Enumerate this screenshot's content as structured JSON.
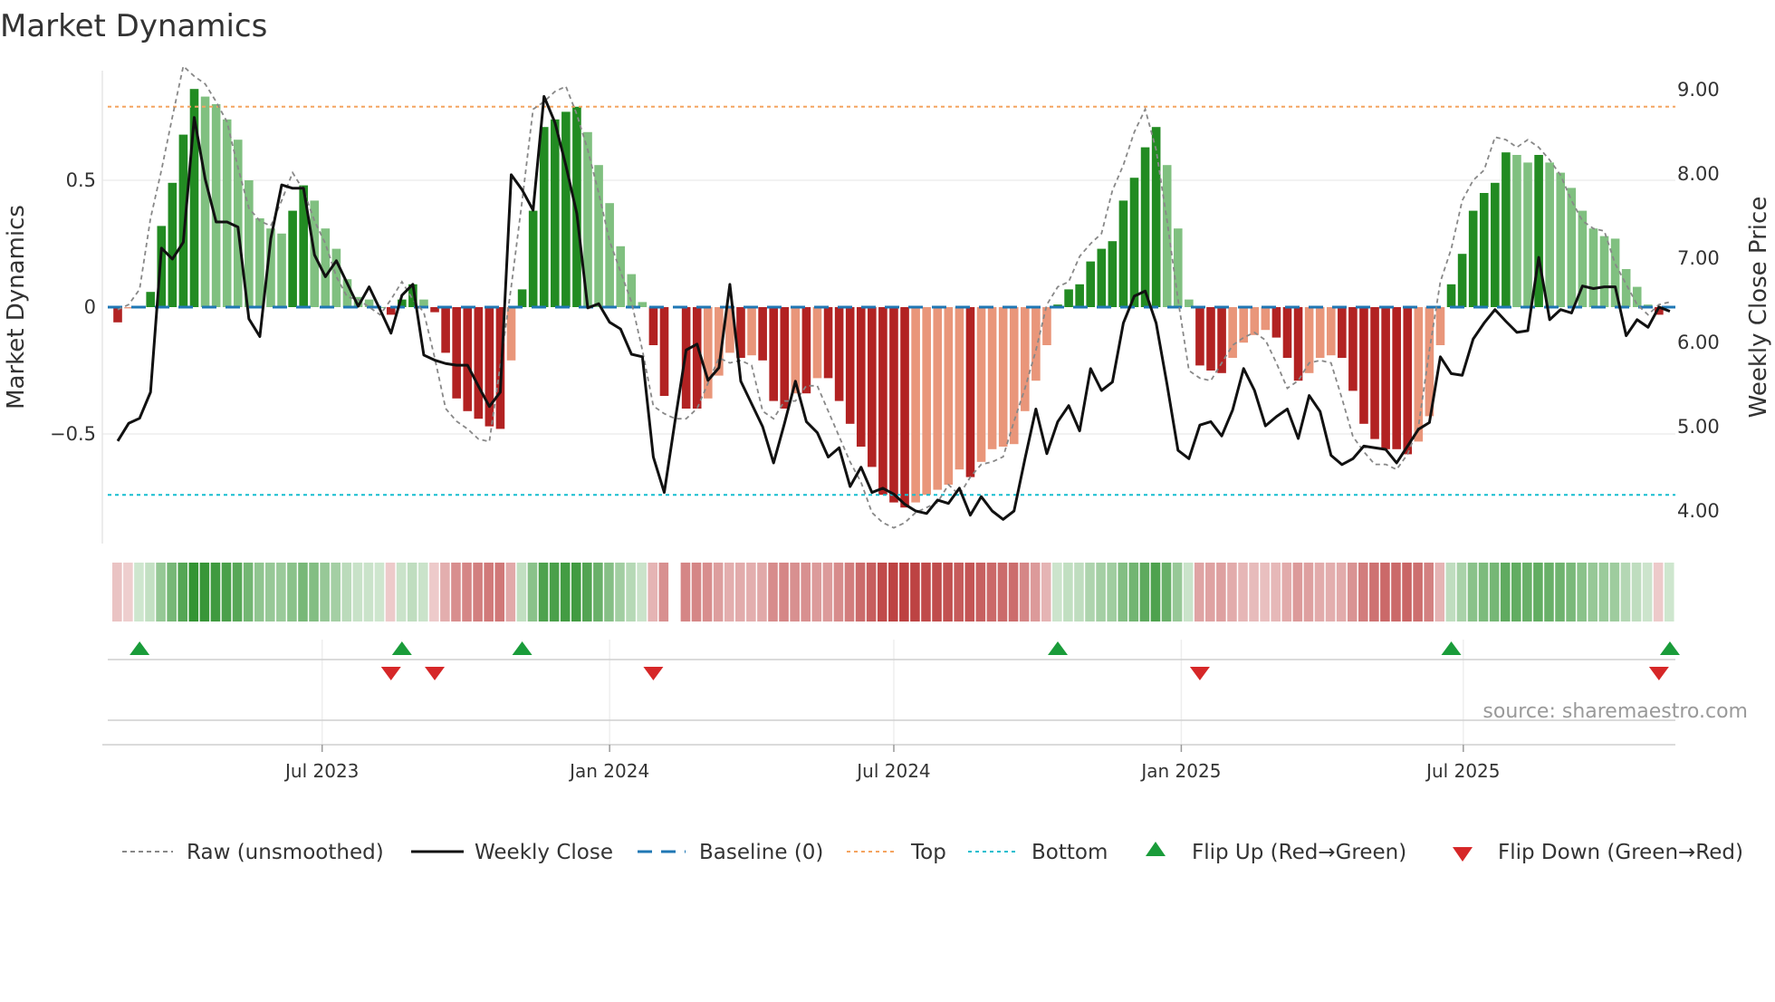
{
  "title": "Market Dynamics",
  "source": "source: sharemaestro.com",
  "colors": {
    "green_dark": "#228b22",
    "green_light": "#80c080",
    "red_dark": "#b22222",
    "red_light": "#e9967a",
    "top": "#f4a460",
    "bottom": "#17becf",
    "baseline": "#1f77b4",
    "price": "#111111",
    "raw": "#888888",
    "flip_up": "#1a9c3a",
    "flip_down": "#d62728"
  },
  "chart_data": {
    "type": "bar+line",
    "title": "Market Dynamics",
    "ylabel_left": "Market Dynamics",
    "ylabel_right": "Weekly Close Price",
    "left_ticks": [
      {
        "v": 0.5,
        "label": "0.5"
      },
      {
        "v": 0,
        "label": "0"
      },
      {
        "v": -0.5,
        "label": "−0.5"
      }
    ],
    "right_ticks": [
      {
        "v": 9,
        "label": "9.00"
      },
      {
        "v": 8,
        "label": "8.00"
      },
      {
        "v": 7,
        "label": "7.00"
      },
      {
        "v": 6,
        "label": "6.00"
      },
      {
        "v": 5,
        "label": "5.00"
      },
      {
        "v": 4,
        "label": "4.00"
      }
    ],
    "x_ticks": [
      {
        "week": 18.7,
        "label": "Jul 2023"
      },
      {
        "week": 45.0,
        "label": "Jan 2024"
      },
      {
        "week": 71.0,
        "label": "Jul 2024"
      },
      {
        "week": 97.3,
        "label": "Jan 2025"
      },
      {
        "week": 123.1,
        "label": "Jul 2025"
      }
    ],
    "top_level": 0.79,
    "bottom_level": -0.74,
    "baseline": 0,
    "dynamics": [
      -0.06,
      -0.005,
      0.005,
      0.06,
      0.32,
      0.49,
      0.68,
      0.86,
      0.83,
      0.8,
      0.74,
      0.66,
      0.5,
      0.35,
      0.31,
      0.29,
      0.38,
      0.48,
      0.42,
      0.31,
      0.23,
      0.11,
      0.04,
      0.03,
      0.0,
      -0.03,
      0.03,
      0.09,
      0.03,
      -0.02,
      -0.18,
      -0.36,
      -0.41,
      -0.44,
      -0.47,
      -0.48,
      -0.21,
      0.07,
      0.38,
      0.71,
      0.74,
      0.77,
      0.79,
      0.69,
      0.56,
      0.41,
      0.24,
      0.13,
      0.02,
      -0.15,
      -0.35,
      null,
      -0.4,
      -0.4,
      -0.36,
      -0.27,
      -0.18,
      -0.2,
      -0.19,
      -0.21,
      -0.37,
      -0.4,
      -0.34,
      -0.34,
      -0.28,
      -0.28,
      -0.37,
      -0.46,
      -0.55,
      -0.63,
      -0.74,
      -0.77,
      -0.79,
      -0.77,
      -0.74,
      -0.72,
      -0.7,
      -0.64,
      -0.67,
      -0.61,
      -0.56,
      -0.55,
      -0.54,
      -0.41,
      -0.29,
      -0.15,
      0.01,
      0.07,
      0.09,
      0.18,
      0.23,
      0.26,
      0.42,
      0.51,
      0.63,
      0.71,
      0.56,
      0.31,
      0.03,
      -0.23,
      -0.25,
      -0.26,
      -0.2,
      -0.14,
      -0.11,
      -0.09,
      -0.12,
      -0.2,
      -0.29,
      -0.26,
      -0.2,
      -0.19,
      -0.2,
      -0.33,
      -0.46,
      -0.52,
      -0.56,
      -0.56,
      -0.58,
      -0.53,
      -0.43,
      -0.15,
      0.09,
      0.21,
      0.38,
      0.45,
      0.49,
      0.61,
      0.6,
      0.57,
      0.6,
      0.57,
      0.53,
      0.47,
      0.38,
      0.31,
      0.28,
      0.27,
      0.15,
      0.08,
      0.01,
      -0.03,
      0.005
    ],
    "raw": [
      -0.01,
      0.01,
      0.07,
      0.35,
      0.54,
      0.75,
      0.95,
      0.91,
      0.88,
      0.81,
      0.73,
      0.55,
      0.39,
      0.34,
      0.32,
      0.42,
      0.53,
      0.46,
      0.34,
      0.25,
      0.12,
      0.04,
      0.03,
      0.0,
      -0.03,
      0.03,
      0.1,
      0.03,
      -0.02,
      -0.2,
      -0.4,
      -0.45,
      -0.48,
      -0.52,
      -0.53,
      -0.23,
      0.08,
      0.42,
      0.78,
      0.81,
      0.85,
      0.87,
      0.76,
      0.62,
      0.45,
      0.26,
      0.14,
      0.02,
      -0.17,
      -0.39,
      -0.42,
      -0.44,
      -0.44,
      -0.4,
      -0.3,
      -0.2,
      -0.22,
      -0.21,
      -0.23,
      -0.41,
      -0.44,
      -0.37,
      -0.37,
      -0.31,
      -0.31,
      -0.41,
      -0.51,
      -0.61,
      -0.69,
      -0.81,
      -0.85,
      -0.87,
      -0.85,
      -0.81,
      -0.79,
      -0.77,
      -0.7,
      -0.74,
      -0.67,
      -0.62,
      -0.61,
      -0.59,
      -0.45,
      -0.32,
      -0.17,
      0.01,
      0.08,
      0.1,
      0.2,
      0.25,
      0.29,
      0.46,
      0.56,
      0.69,
      0.78,
      0.62,
      0.34,
      0.03,
      -0.25,
      -0.28,
      -0.29,
      -0.22,
      -0.15,
      -0.12,
      -0.1,
      -0.13,
      -0.22,
      -0.32,
      -0.29,
      -0.22,
      -0.21,
      -0.22,
      -0.36,
      -0.51,
      -0.57,
      -0.62,
      -0.62,
      -0.64,
      -0.58,
      -0.47,
      -0.17,
      0.1,
      0.23,
      0.42,
      0.5,
      0.54,
      0.67,
      0.66,
      0.63,
      0.66,
      0.63,
      0.58,
      0.52,
      0.42,
      0.34,
      0.31,
      0.3,
      0.17,
      0.09,
      0.01,
      -0.03,
      0.01,
      0.02
    ],
    "weekly_close": [
      4.83,
      5.04,
      5.1,
      5.41,
      7.12,
      6.99,
      7.19,
      8.67,
      7.94,
      7.43,
      7.43,
      7.37,
      6.28,
      6.07,
      7.23,
      7.87,
      7.83,
      7.83,
      7.04,
      6.78,
      6.97,
      6.7,
      6.43,
      6.66,
      6.39,
      6.11,
      6.56,
      6.69,
      5.85,
      5.79,
      5.75,
      5.73,
      5.73,
      5.48,
      5.24,
      5.41,
      7.99,
      7.81,
      7.57,
      8.92,
      8.61,
      8.1,
      7.53,
      6.41,
      6.46,
      6.24,
      6.16,
      5.86,
      5.83,
      4.64,
      4.22,
      5.08,
      5.91,
      5.98,
      5.55,
      5.7,
      6.69,
      5.54,
      5.27,
      5.0,
      4.57,
      5.04,
      5.54,
      5.06,
      4.93,
      4.64,
      4.75,
      4.29,
      4.52,
      4.22,
      4.27,
      4.2,
      4.08,
      4.0,
      3.97,
      4.13,
      4.09,
      4.27,
      3.95,
      4.17,
      4.0,
      3.9,
      4.0,
      4.62,
      5.21,
      4.68,
      5.06,
      5.25,
      4.95,
      5.69,
      5.43,
      5.53,
      6.23,
      6.55,
      6.61,
      6.23,
      5.5,
      4.72,
      4.62,
      5.02,
      5.06,
      4.89,
      5.2,
      5.69,
      5.43,
      5.01,
      5.12,
      5.21,
      4.86,
      5.37,
      5.18,
      4.66,
      4.55,
      4.62,
      4.77,
      4.75,
      4.73,
      4.57,
      4.77,
      4.97,
      5.05,
      5.83,
      5.63,
      5.61,
      6.04,
      6.23,
      6.39,
      6.25,
      6.12,
      6.14,
      7.01,
      6.27,
      6.39,
      6.35,
      6.67,
      6.64,
      6.66,
      6.66,
      6.08,
      6.27,
      6.18,
      6.42,
      6.37
    ],
    "flips_up": [
      2,
      26,
      37,
      86,
      122,
      142
    ],
    "flips_down": [
      25,
      29,
      49,
      99,
      141
    ],
    "legend": {
      "placement": "bottom",
      "raw": "Raw (unsmoothed)",
      "close": "Weekly Close",
      "baseline": "Baseline (0)",
      "top": "Top",
      "bottom": "Bottom",
      "flip_up": "Flip Up (Red→Green)",
      "flip_down": "Flip Down (Green→Red)"
    }
  }
}
